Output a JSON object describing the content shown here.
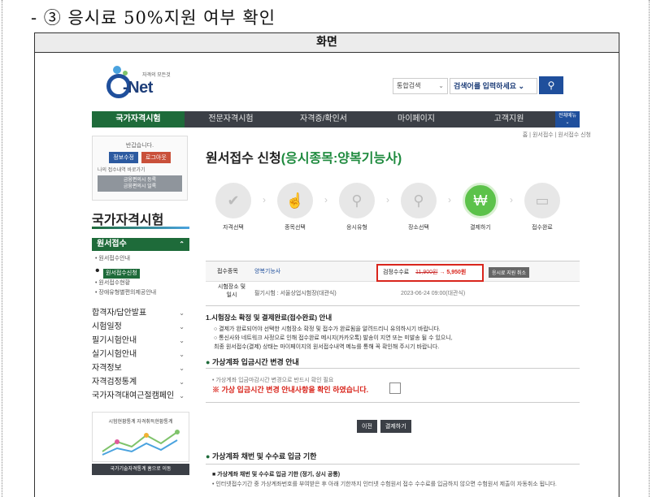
{
  "document": {
    "heading": "- ③ 응시료 50%지원 여부 확인",
    "box_title": "화면"
  },
  "header": {
    "logo_sub": "자격의 모든것",
    "logo_brand": "Net",
    "search_scope": "통합검색",
    "search_placeholder": "검색어를 입력하세요",
    "search_icon": "magnifier-icon"
  },
  "gnb": {
    "items": [
      "국가자격시험",
      "전문자격시험",
      "자격증/확인서",
      "마이페이지",
      "고객지원"
    ],
    "all_menu": "전체메뉴"
  },
  "breadcrumb": "홈 | 원서접수 | 원서접수 신청",
  "login": {
    "greeting": "반갑습니다.",
    "edit_btn": "정보수정",
    "logout_btn": "로그아웃",
    "note": "나의 접수내역 바로가기",
    "grey_btn_1": "금융편의시 등록",
    "grey_btn_2": "금융편의시 일록"
  },
  "sidebar": {
    "title": "국가자격시험",
    "selected": "원서접수",
    "sub_items": [
      "원서접수안내",
      "원서접수신청",
      "원서접수현황",
      "장애유형별편의제공안내"
    ],
    "menu": [
      "합격자/답안발표",
      "시험일정",
      "필기시험안내",
      "실기시험안내",
      "자격정보",
      "자격검정통계",
      "국가자격대여근절캠페인"
    ],
    "stats_label": "시험현황통계 자격취득현황통계",
    "stats_btn": "국가기술자격통계 홈으로 이동"
  },
  "main": {
    "title_prefix": "원서접수 신청",
    "title_accent": "(응시종목:양복기능사)",
    "steps": [
      "자격선택",
      "종목선택",
      "응시유형",
      "장소선택",
      "결제하기",
      "접수완료"
    ],
    "row_item_label": "접수종목",
    "row_item_value": "양복기능사",
    "fee_label": "검정수수료",
    "fee_old": "11,900원",
    "fee_new": "→ 5,950원",
    "fee_cancel": "응시료 지원 취소",
    "place_label": "시험장소 및 일시",
    "place_value": "필기시험 : 서울상업시험장(대관식)",
    "date_value": "2023-06-24 09:00(대관식)",
    "notice_head": "1.시험장소 확정 및 결제완료(접수완료) 안내",
    "notice_lines": [
      "○ 결제가 완료되어야 선택한 시험장소 확정 및 접수가 완료됨을 알려드리니 유의하시기 바랍니다.",
      "○ 통신사와 네트워크 사정으로 인해 접수완료 메시지(카카오톡) 발송이 지연 또는 미발송 될 수 있으니,",
      "   최종 원서접수(결제) 상태는 마이페이지의 원서접수내역 메뉴를 통해 꼭 확인해 주시기 바랍니다."
    ],
    "sec2_title": "가상계좌 입금시간 변경 안내",
    "warn1": "• 가상계좌 입금마감시간 변경으로 반드시 확인 필요",
    "warn2": "※ 가상 입금시간 변경 안내사항을 확인 하였습니다.",
    "prev_btn": "이전",
    "pay_btn": "결제하기",
    "sec3_title": "가상계좌 채번 및 수수료 입금 기한",
    "sec3_sub": "■ 가상계좌 채번 및 수수료 입금 기한 (정기, 상시 공통)",
    "sec3_text": "• 인터넷접수기간 중 가상계좌번호를 부여받은 후 아래 기한까지 인터넷 수험원서 접수 수수료를 입금하지 않으면 수험원서 제출이 자동취소 됩니다."
  }
}
